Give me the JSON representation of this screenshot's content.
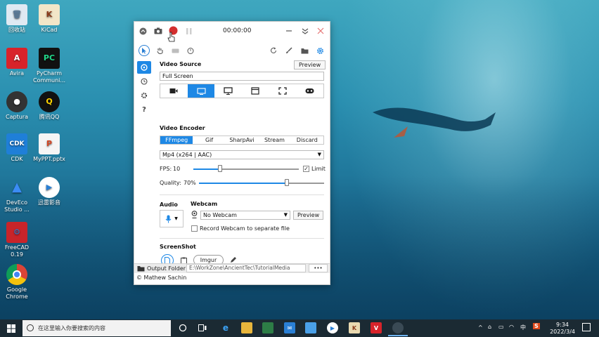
{
  "desktop": {
    "icons": [
      {
        "label": "回收站",
        "icon": "recycle-bin-icon"
      },
      {
        "label": "KiCad",
        "icon": "kicad-icon"
      },
      {
        "label": "Avira",
        "icon": "avira-icon"
      },
      {
        "label": "PyCharm Communi...",
        "icon": "pycharm-icon"
      },
      {
        "label": "Captura",
        "icon": "captura-icon"
      },
      {
        "label": "腾讯QQ",
        "icon": "qq-icon"
      },
      {
        "label": "CDK",
        "icon": "cdk-icon"
      },
      {
        "label": "MyPPT.pptx",
        "icon": "pptx-file-icon"
      },
      {
        "label": "DevEco Studio ...",
        "icon": "deveco-icon"
      },
      {
        "label": "迅雷影音",
        "icon": "xunlei-player-icon"
      },
      {
        "label": "FreeCAD 0.19",
        "icon": "freecad-icon"
      },
      {
        "label": "Google Chrome",
        "icon": "chrome-icon"
      }
    ]
  },
  "app": {
    "timer": "00:00:00",
    "video_source": {
      "title": "Video Source",
      "preview_label": "Preview",
      "source_value": "Full Screen",
      "source_types": [
        "camera",
        "screen",
        "monitor",
        "window",
        "region",
        "gamepad"
      ],
      "active_index": 1
    },
    "video_encoder": {
      "title": "Video Encoder",
      "tabs": [
        "FFmpeg",
        "Gif",
        "SharpAvi",
        "Stream",
        "Discard"
      ],
      "active_index": 0,
      "codec": "Mp4 (x264 | AAC)",
      "fps_label": "FPS:",
      "fps_value": "10",
      "fps_fraction": 0.25,
      "limit_label": "Limit",
      "limit_checked": true,
      "quality_label": "Quality:",
      "quality_value": "70%",
      "quality_fraction": 0.7
    },
    "audio": {
      "title": "Audio"
    },
    "webcam": {
      "title": "Webcam",
      "selected": "No Webcam",
      "preview_label": "Preview",
      "separate_file_label": "Record Webcam to separate file",
      "separate_file_checked": false
    },
    "screenshot": {
      "title": "ScreenShot",
      "imgur_label": "Imgur"
    },
    "output": {
      "label": "Output Folder",
      "path": "E:\\WorkZone\\AncientTec\\TutorialMedia",
      "more_label": "•••"
    },
    "credit": "© Mathew Sachin"
  },
  "taskbar": {
    "search_placeholder": "在这里输入你要搜索的内容",
    "ime": "中",
    "time": "9:34",
    "date": "2022/3/4"
  },
  "colors": {
    "accent": "#1e88e5",
    "record": "#d32f2f"
  }
}
